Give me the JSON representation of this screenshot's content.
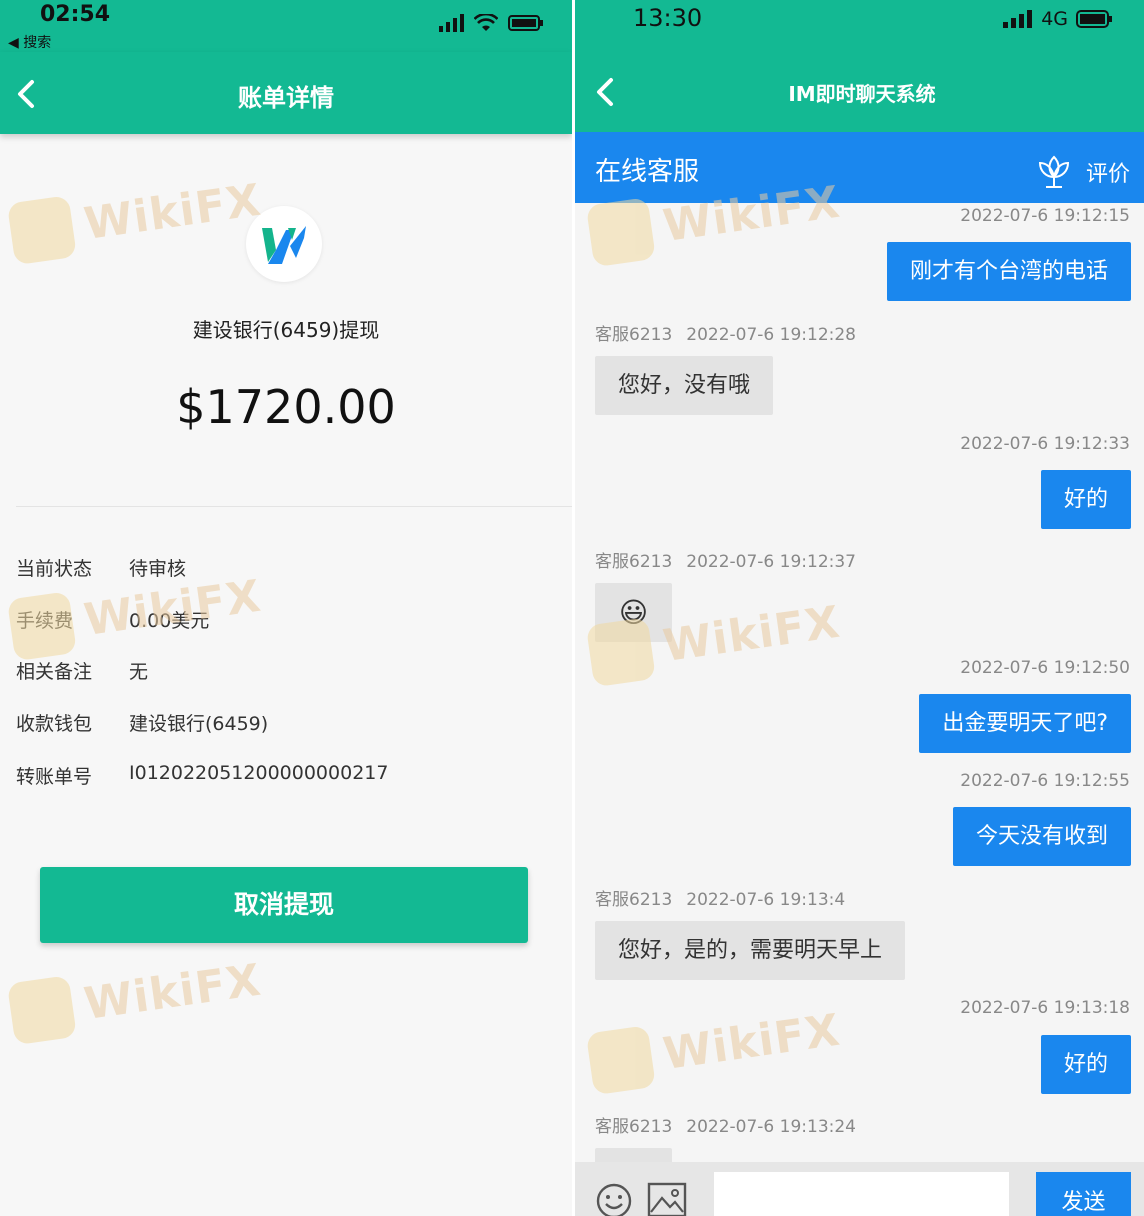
{
  "left": {
    "status": {
      "time": "02:54",
      "back_app": "◀ 搜索"
    },
    "nav": {
      "title": "账单详情"
    },
    "bank_title": "建设银行(6459)提现",
    "amount": "$1720.00",
    "details": [
      {
        "label": "当前状态",
        "value": "待审核"
      },
      {
        "label": "手续费",
        "value": "0.00美元"
      },
      {
        "label": "相关备注",
        "value": "无"
      },
      {
        "label": "收款钱包",
        "value": "建设银行(6459)"
      },
      {
        "label": "转账单号",
        "value": "I012022051200000000217"
      }
    ],
    "cancel_button": "取消提现",
    "colors": {
      "primary": "#13b993",
      "logo_green": "#14b48c",
      "logo_blue": "#1a87ee"
    }
  },
  "right": {
    "status": {
      "time": "13:30",
      "network": "4G"
    },
    "nav": {
      "title": "IM即时聊天系统"
    },
    "cs_bar": {
      "title": "在线客服",
      "rate_label": "评价"
    },
    "messages": [
      {
        "side": "me",
        "timestamp": "2022-07-6 19:12:15",
        "text": "刚才有个台湾的电话"
      },
      {
        "side": "them",
        "agent": "客服6213",
        "timestamp": "2022-07-6 19:12:28",
        "text": "您好，没有哦"
      },
      {
        "side": "me",
        "timestamp": "2022-07-6 19:12:33",
        "text": "好的"
      },
      {
        "side": "them",
        "agent": "客服6213",
        "timestamp": "2022-07-6 19:12:37",
        "emoji": "😃"
      },
      {
        "side": "me",
        "timestamp": "2022-07-6 19:12:50",
        "text": "出金要明天了吧?"
      },
      {
        "side": "me",
        "timestamp": "2022-07-6 19:12:55",
        "text": "今天没有收到"
      },
      {
        "side": "them",
        "agent": "客服6213",
        "timestamp": "2022-07-6 19:13:4",
        "text": "您好，是的，需要明天早上"
      },
      {
        "side": "me",
        "timestamp": "2022-07-6 19:13:18",
        "text": "好的"
      },
      {
        "side": "them",
        "agent": "客服6213",
        "timestamp": "2022-07-6 19:13:24"
      }
    ],
    "input": {
      "send_label": "发送"
    },
    "colors": {
      "primary": "#13b993",
      "accent": "#1a87ee"
    }
  },
  "watermark": {
    "text": "WikiFX"
  }
}
